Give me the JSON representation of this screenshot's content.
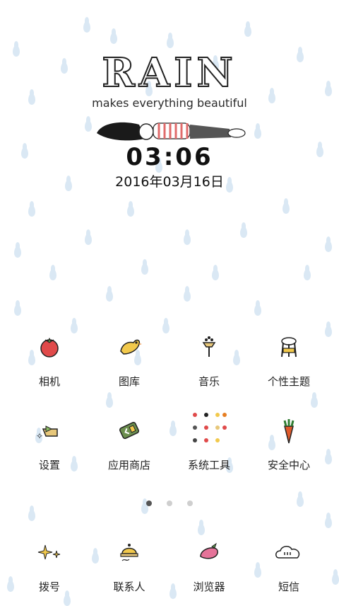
{
  "widget": {
    "title": "RAIN",
    "tagline": "makes everything beautiful",
    "time": "03:06",
    "date": "2016年03月16日"
  },
  "apps_row1": [
    {
      "label": "相机",
      "icon": "tomato-icon"
    },
    {
      "label": "图库",
      "icon": "bird-icon"
    },
    {
      "label": "音乐",
      "icon": "music-stand-icon"
    },
    {
      "label": "个性主题",
      "icon": "stool-icon"
    }
  ],
  "apps_row2": [
    {
      "label": "设置",
      "icon": "sparkle-folder-icon"
    },
    {
      "label": "应用商店",
      "icon": "bag-icon"
    },
    {
      "label": "系统工具",
      "icon": "tools-folder-icon"
    },
    {
      "label": "安全中心",
      "icon": "carrot-icon"
    }
  ],
  "pager": {
    "pages": 3,
    "active": 0
  },
  "dock": [
    {
      "label": "拨号",
      "icon": "sparkles-icon"
    },
    {
      "label": "联系人",
      "icon": "bell-icon"
    },
    {
      "label": "浏览器",
      "icon": "peach-icon"
    },
    {
      "label": "短信",
      "icon": "cloud-icon"
    }
  ],
  "colors": {
    "raindrop": "#d7e6f3",
    "text": "#222222"
  }
}
